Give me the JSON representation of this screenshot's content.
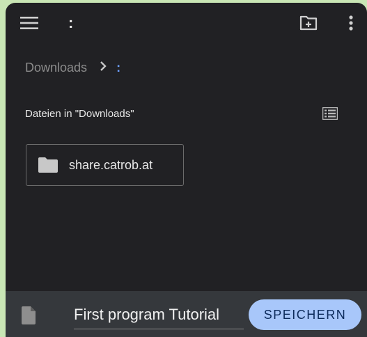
{
  "toolbar": {
    "menu_icon": "menu-icon",
    "title": ":",
    "new_folder_icon": "create-new-folder-icon",
    "overflow_icon": "more-vert-icon"
  },
  "breadcrumb": {
    "items": [
      "Downloads",
      ":"
    ],
    "separator_icon": "chevron-right-icon"
  },
  "section": {
    "header": "Dateien in \"Downloads\"",
    "view_toggle_icon": "list-view-icon"
  },
  "folders": [
    {
      "name": "share.catrob.at",
      "icon": "folder-icon"
    }
  ],
  "bottom_bar": {
    "file_icon": "file-icon",
    "filename": "First program Tutorial",
    "save_label": "SPEICHERN"
  },
  "colors": {
    "background": "#212124",
    "bottom_bar": "#35383c",
    "accent": "#a8c7fa",
    "accent_text": "#0b2a5a",
    "breadcrumb_active": "#6ea0ff"
  }
}
